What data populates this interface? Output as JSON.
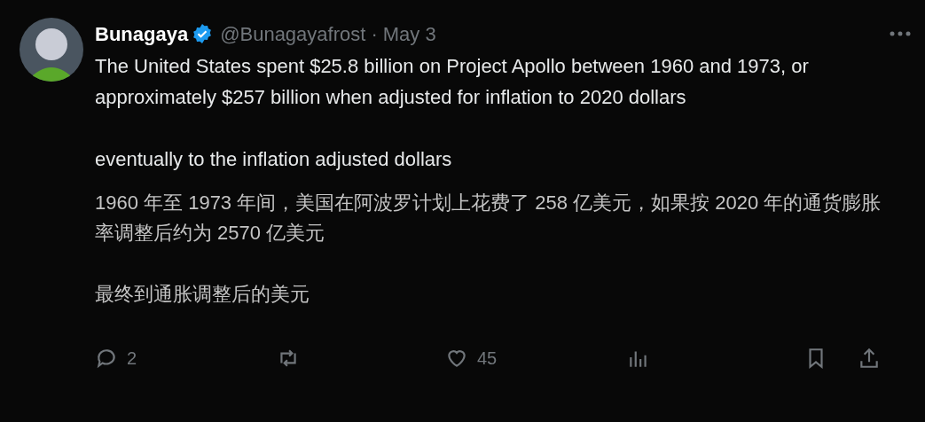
{
  "author": {
    "name": "Bunagaya",
    "verified": true,
    "handle": "@Bunagayafrost",
    "separator": "·",
    "date": "May 3"
  },
  "paragraphs": [
    {
      "kind": "original",
      "text": "The United States spent $25.8 billion on Project Apollo between 1960 and 1973, or approximately $257 billion when adjusted for inflation to 2020 dollars"
    },
    {
      "kind": "original",
      "text": "eventually to the inflation adjusted dollars"
    },
    {
      "kind": "translation",
      "text": "1960 年至 1973 年间，美国在阿波罗计划上花费了 258 亿美元，如果按 2020 年的通货膨胀率调整后约为 2570 亿美元"
    },
    {
      "kind": "translation",
      "text": "最终到通胀调整后的美元"
    }
  ],
  "actions": [
    {
      "kind": "reply",
      "count": "2"
    },
    {
      "kind": "repost"
    },
    {
      "kind": "like",
      "count": "45"
    },
    {
      "kind": "views"
    },
    {
      "kind": "bookmark"
    },
    {
      "kind": "share"
    }
  ]
}
